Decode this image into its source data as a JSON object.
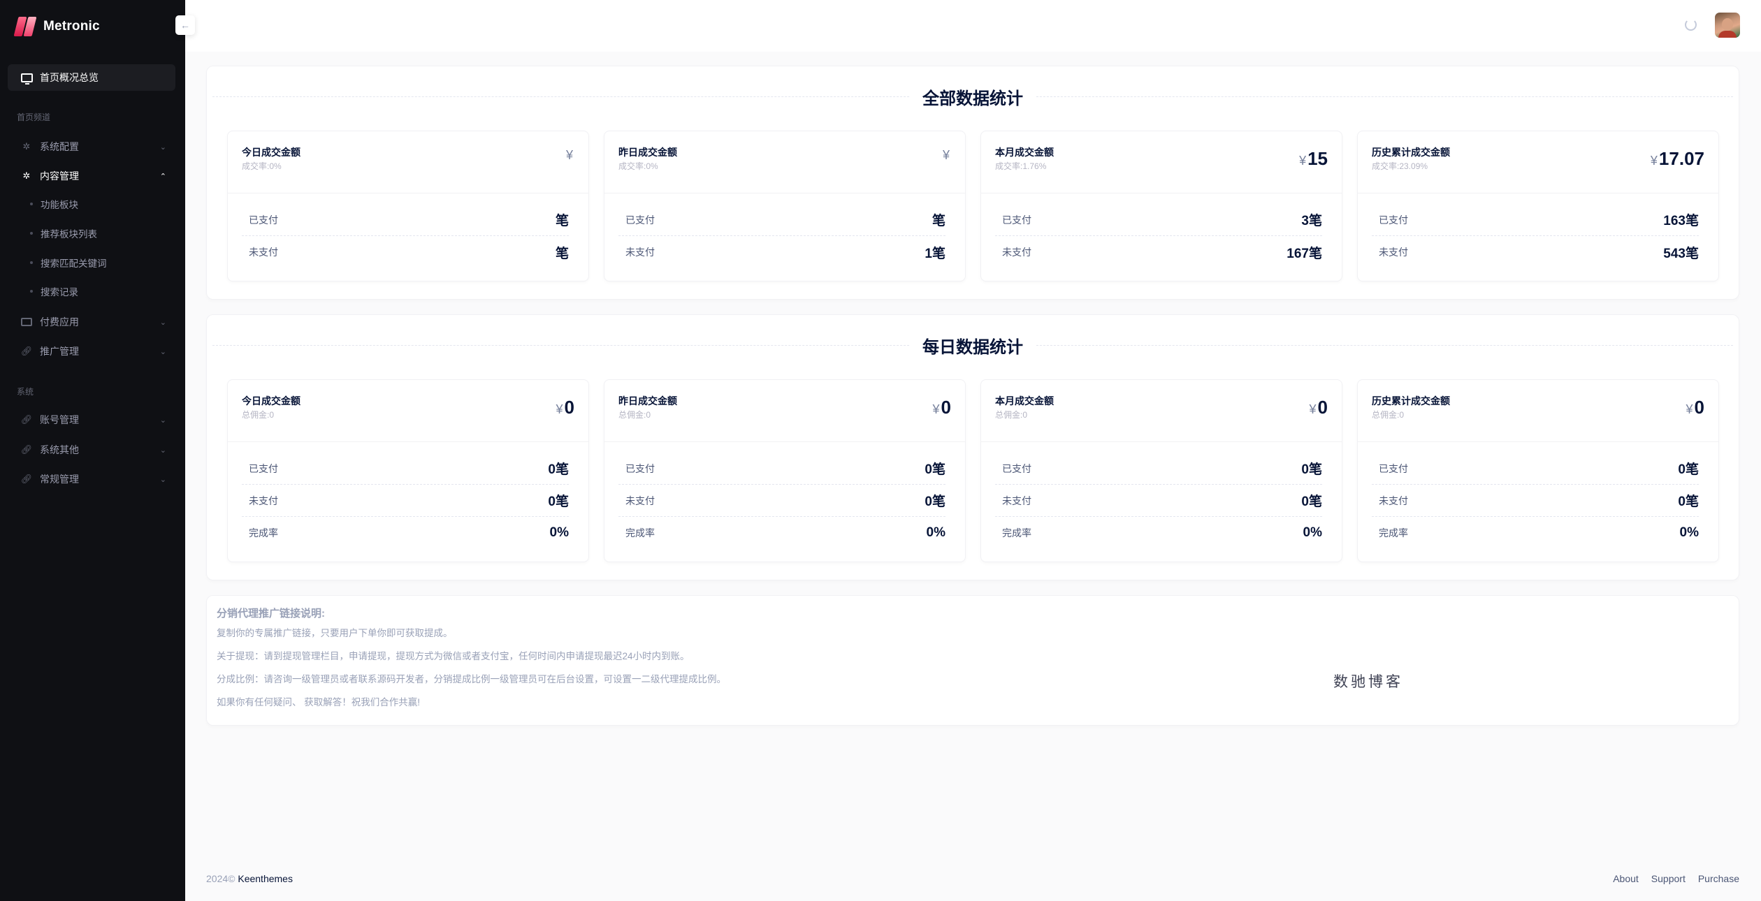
{
  "app": {
    "name": "Metronic"
  },
  "sidebar": {
    "active_item": "首页概况总览",
    "section_1": "首页频道",
    "section_2": "系统",
    "items": [
      {
        "label": "系统配置"
      },
      {
        "label": "内容管理"
      },
      {
        "label": "付费应用"
      },
      {
        "label": "推广管理"
      },
      {
        "label": "账号管理"
      },
      {
        "label": "系统其他"
      },
      {
        "label": "常规管理"
      }
    ],
    "sub_items": [
      {
        "label": "功能板块"
      },
      {
        "label": "推荐板块列表"
      },
      {
        "label": "搜索匹配关键词"
      },
      {
        "label": "搜索记录"
      }
    ]
  },
  "overall": {
    "title": "全部数据统计",
    "cards": [
      {
        "title": "今日成交金额",
        "sub": "成交率:0%",
        "currency": "¥",
        "amount": "",
        "paid_label": "已支付",
        "paid": "笔",
        "unpaid_label": "未支付",
        "unpaid": "笔"
      },
      {
        "title": "昨日成交金额",
        "sub": "成交率:0%",
        "currency": "¥",
        "amount": "",
        "paid_label": "已支付",
        "paid": "笔",
        "unpaid_label": "未支付",
        "unpaid": "1笔"
      },
      {
        "title": "本月成交金额",
        "sub": "成交率:1.76%",
        "currency": "¥",
        "amount": "15",
        "paid_label": "已支付",
        "paid": "3笔",
        "unpaid_label": "未支付",
        "unpaid": "167笔"
      },
      {
        "title": "历史累计成交金额",
        "sub": "成交率:23.09%",
        "currency": "¥",
        "amount": "17.07",
        "paid_label": "已支付",
        "paid": "163笔",
        "unpaid_label": "未支付",
        "unpaid": "543笔"
      }
    ]
  },
  "daily": {
    "title": "每日数据统计",
    "cards": [
      {
        "title": "今日成交金额",
        "sub": "总佣金:0",
        "currency": "¥",
        "amount": "0",
        "paid_label": "已支付",
        "paid": "0笔",
        "unpaid_label": "未支付",
        "unpaid": "0笔",
        "rate_label": "完成率",
        "rate": "0%"
      },
      {
        "title": "昨日成交金额",
        "sub": "总佣金:0",
        "currency": "¥",
        "amount": "0",
        "paid_label": "已支付",
        "paid": "0笔",
        "unpaid_label": "未支付",
        "unpaid": "0笔",
        "rate_label": "完成率",
        "rate": "0%"
      },
      {
        "title": "本月成交金额",
        "sub": "总佣金:0",
        "currency": "¥",
        "amount": "0",
        "paid_label": "已支付",
        "paid": "0笔",
        "unpaid_label": "未支付",
        "unpaid": "0笔",
        "rate_label": "完成率",
        "rate": "0%"
      },
      {
        "title": "历史累计成交金额",
        "sub": "总佣金:0",
        "currency": "¥",
        "amount": "0",
        "paid_label": "已支付",
        "paid": "0笔",
        "unpaid_label": "未支付",
        "unpaid": "0笔",
        "rate_label": "完成率",
        "rate": "0%"
      }
    ]
  },
  "notes": {
    "title": "分销代理推广链接说明:",
    "lines": [
      "复制你的专属推广链接，只要用户下单你即可获取提成。",
      "关于提现：请到提现管理栏目，申请提现，提现方式为微信或者支付宝，任何时间内申请提现最迟24小时内到账。",
      "分成比例：请咨询一级管理员或者联系源码开发者，分销提成比例一级管理员可在后台设置，可设置一二级代理提成比例。",
      "如果你有任何疑问、 获取解答！祝我们合作共赢!"
    ],
    "watermark": "数驰博客"
  },
  "footer": {
    "copyright": "2024©",
    "company": "Keenthemes",
    "links": [
      "About",
      "Support",
      "Purchase"
    ]
  }
}
